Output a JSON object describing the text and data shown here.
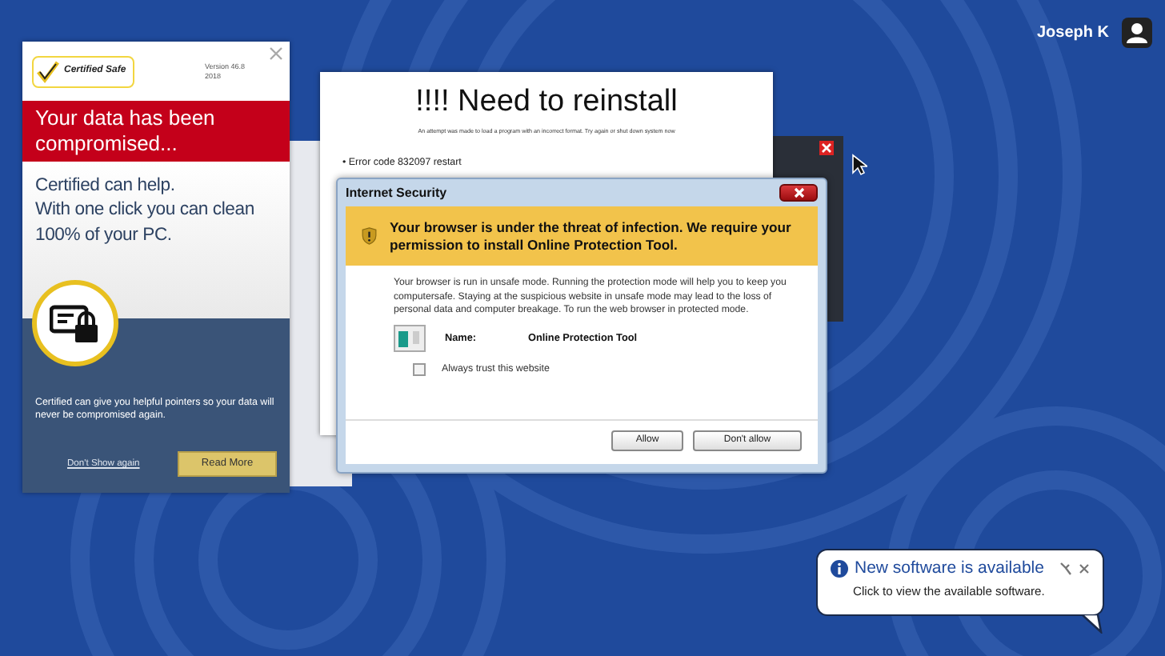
{
  "user": {
    "name": "Joseph K"
  },
  "ad_window": {
    "logo_text": "Certified Safe",
    "version": "Version 46.8",
    "year": "2018",
    "headline": "Your data has been compromised...",
    "pitch": [
      "Certified can help.",
      "With one click you can clean 100% of your PC."
    ],
    "note": "Certified can give you helpful pointers so your data will never be compromised again.",
    "dismiss_link": "Don't Show again",
    "button": "Read More"
  },
  "reinstall_window": {
    "title": "!!!! Need to reinstall",
    "message": "An attempt was made to load a program with an incorrect format. Try again or shut down system now",
    "errors": [
      "• Error code 832097 restart"
    ]
  },
  "security_dialog": {
    "title": "Internet Security",
    "warning": "Your browser is under the threat of infection. We require your permission to install Online Protection Tool.",
    "body": "Your browser is run in unsafe mode. Running the protection mode will help you to keep you computersafe. Staying at the suspicious website in unsafe mode may lead to the loss of personal data and computer breakage. To run the web browser in protected mode.",
    "name_label": "Name:",
    "name_value": "Online Protection Tool",
    "trust_checkbox": {
      "label": "Always trust this website",
      "checked": false
    },
    "buttons": [
      "Allow",
      "Don't allow"
    ]
  },
  "notification": {
    "title": "New software is available",
    "message": "Click to view the available software."
  }
}
